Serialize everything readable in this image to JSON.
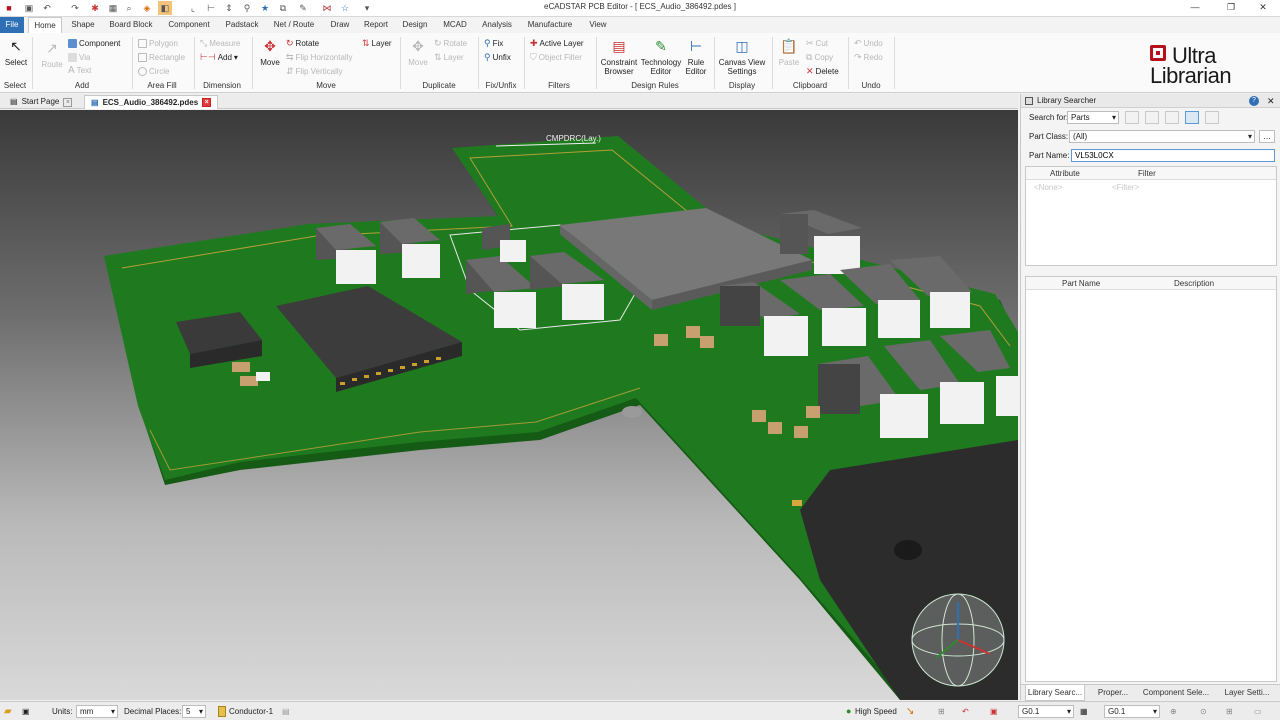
{
  "window": {
    "title": "eCADSTAR PCB Editor - [ ECS_Audio_386492.pdes ]",
    "controls": {
      "minimize": "—",
      "restore": "❐",
      "close": "✕"
    }
  },
  "menu": {
    "tabs": [
      "File",
      "Home",
      "Shape",
      "Board Block",
      "Component",
      "Padstack",
      "Net / Route",
      "Draw",
      "Report",
      "Design",
      "MCAD",
      "Analysis",
      "Manufacture",
      "View"
    ],
    "active": "Home"
  },
  "ribbon": {
    "select": {
      "label": "Select",
      "group": "Select"
    },
    "add": {
      "route": "Route",
      "component": "Component",
      "via": "Via",
      "text": "Text",
      "group": "Add"
    },
    "area_fill": {
      "polygon": "Polygon",
      "rectangle": "Rectangle",
      "circle": "Circle",
      "group": "Area Fill"
    },
    "dimension": {
      "measure": "Measure",
      "add": "Add",
      "group": "Dimension"
    },
    "move": {
      "move": "Move",
      "rotate": "Rotate",
      "layer": "Layer",
      "flip_h": "Flip Horizontally",
      "flip_v": "Flip Vertically",
      "group": "Move"
    },
    "duplicate": {
      "move": "Move",
      "rotate": "Rotate",
      "layer": "Layer",
      "group": "Duplicate"
    },
    "fix": {
      "fix": "Fix",
      "unfix": "Unfix",
      "group": "Fix/Unfix"
    },
    "filters": {
      "active_layer": "Active Layer",
      "object_filter": "Object Filter",
      "group": "Filters"
    },
    "design_rules": {
      "constraint": "Constraint Browser",
      "technology": "Technology Editor",
      "rule": "Rule Editor",
      "group": "Design Rules"
    },
    "display": {
      "canvas_view": "Canvas View Settings",
      "group": "Display"
    },
    "clipboard": {
      "paste": "Paste",
      "cut": "Cut",
      "copy": "Copy",
      "delete": "Delete",
      "group": "Clipboard"
    },
    "undo": {
      "undo": "Undo",
      "redo": "Redo",
      "group": "Undo"
    }
  },
  "logo": {
    "line1": "Ultra",
    "line2": "Librarian"
  },
  "doc_tabs": [
    {
      "label": "Start Page",
      "active": false
    },
    {
      "label": "ECS_Audio_386492.pdes",
      "active": true
    }
  ],
  "canvas": {
    "silk_label": "CMPDRC(Lay.)"
  },
  "panel": {
    "title": "Library Searcher",
    "search_for_label": "Search for:",
    "search_for_value": "Parts",
    "part_class_label": "Part Class:",
    "part_class_value": "(All)",
    "part_name_label": "Part Name:",
    "part_name_value": "VL53L0CX",
    "attr_col": "Attribute",
    "filter_col": "Filter",
    "attr_placeholder": "<None>",
    "filter_placeholder": "<Filter>",
    "result_cols": [
      "Part Name",
      "Description"
    ],
    "bottom_tabs": [
      "Library Searc...",
      "Proper...",
      "Component Sele...",
      "Layer Setti..."
    ]
  },
  "status": {
    "units_label": "Units:",
    "units_value": "mm",
    "decimal_label": "Decimal Places:",
    "decimal_value": "5",
    "layer_value": "Conductor-1",
    "highspeed": "High Speed",
    "grid1": "G0.1",
    "grid2": "G0.1"
  },
  "colors": {
    "file_tab": "#2f6fb5",
    "board": "#1f7a1f",
    "logo_red": "#b5121b"
  }
}
